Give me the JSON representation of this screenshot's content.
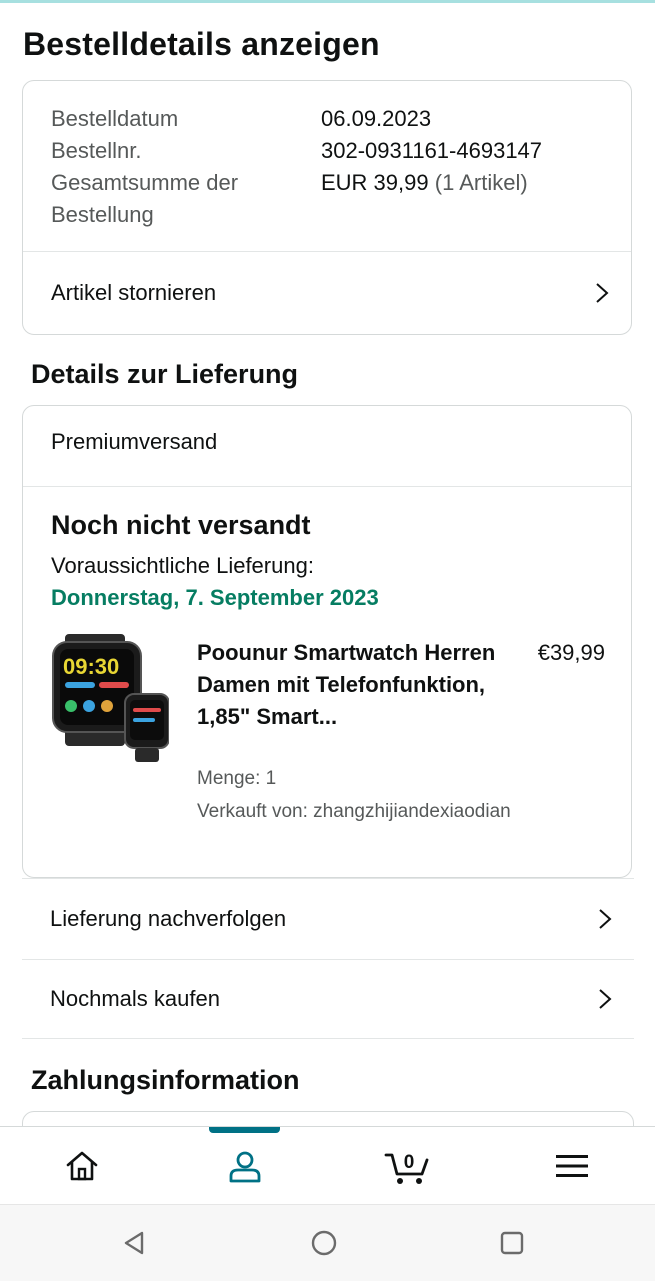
{
  "page": {
    "title": "Bestelldetails anzeigen"
  },
  "summary": {
    "date_label": "Bestelldatum",
    "date_value": "06.09.2023",
    "order_label": "Bestellnr.",
    "order_value": "302-0931161-4693147",
    "total_label_line1": "Gesamtsumme der",
    "total_label_line2": "Bestellung",
    "total_value": "EUR 39,99",
    "total_items": "(1 Artikel)",
    "cancel_label": "Artikel stornieren"
  },
  "delivery": {
    "section_title": "Details zur Lieferung",
    "shipping_method": "Premiumversand",
    "status": "Noch nicht versandt",
    "eta_label": "Voraussichtliche Lieferung:",
    "eta_date": "Donnerstag, 7. September 2023",
    "product": {
      "title": "Poounur Smartwatch Herren Damen mit Telefonfunktion, 1,85\" Smart...",
      "price": "€39,99",
      "quantity": "Menge: 1",
      "seller": "Verkauft von: zhangzhijiandexiaodian",
      "image_time": "09:30"
    },
    "track_label": "Lieferung nachverfolgen",
    "buy_again_label": "Nochmals kaufen"
  },
  "payment": {
    "section_title": "Zahlungsinformation"
  },
  "tabbar": {
    "active": "account",
    "cart_count": "0",
    "icons": [
      "home-icon",
      "account-icon",
      "cart-icon",
      "menu-icon"
    ]
  },
  "colors": {
    "accent": "#007185",
    "eta": "#067d62",
    "border": "#d5d9d9"
  }
}
